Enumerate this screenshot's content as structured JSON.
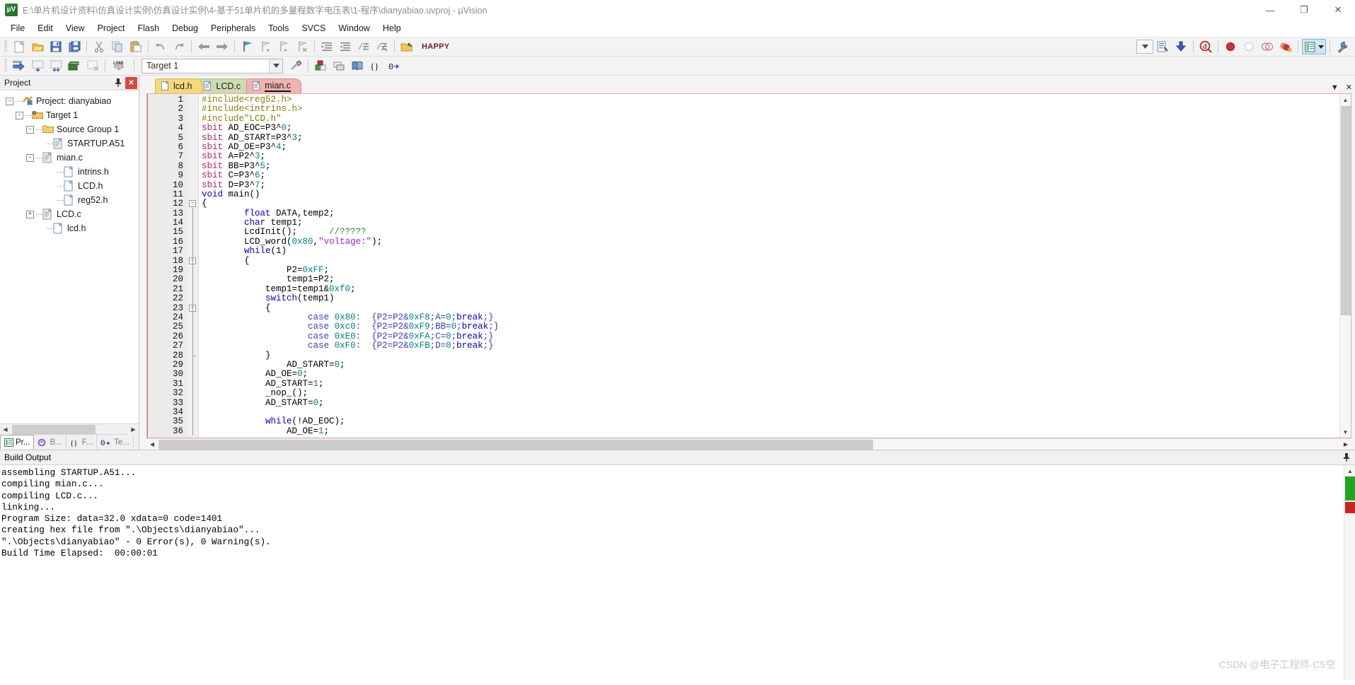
{
  "window": {
    "title": "E:\\单片机设计资料\\仿真设计实例\\仿真设计实例\\4-基于51单片机的多量程数字电压表\\1-程序\\dianyabiao.uvproj - µVision",
    "logo_text": "µV",
    "minimize": "—",
    "maximize": "❐",
    "close": "✕"
  },
  "menubar": {
    "items": [
      "File",
      "Edit",
      "View",
      "Project",
      "Flash",
      "Debug",
      "Peripherals",
      "Tools",
      "SVCS",
      "Window",
      "Help"
    ]
  },
  "toolbar1": {
    "buttons": [
      {
        "name": "new-file-icon",
        "title": "New"
      },
      {
        "name": "open-file-icon",
        "title": "Open"
      },
      {
        "name": "save-icon",
        "title": "Save"
      },
      {
        "name": "save-all-icon",
        "title": "Save All"
      },
      {
        "name": "cut-icon",
        "title": "Cut"
      },
      {
        "name": "copy-icon",
        "title": "Copy"
      },
      {
        "name": "paste-icon",
        "title": "Paste"
      },
      {
        "name": "undo-icon",
        "title": "Undo"
      },
      {
        "name": "redo-icon",
        "title": "Redo"
      },
      {
        "name": "back-icon",
        "title": "Back"
      },
      {
        "name": "forward-icon",
        "title": "Forward"
      },
      {
        "name": "bookmark-toggle-icon",
        "title": "Insert/Remove Bookmark"
      },
      {
        "name": "bookmark-prev-icon",
        "title": "Previous Bookmark"
      },
      {
        "name": "bookmark-next-icon",
        "title": "Next Bookmark"
      },
      {
        "name": "bookmark-clear-icon",
        "title": "Clear All Bookmarks"
      },
      {
        "name": "indent-icon",
        "title": "Indent"
      },
      {
        "name": "outdent-icon",
        "title": "Outdent"
      },
      {
        "name": "comment-icon",
        "title": "Comment"
      },
      {
        "name": "uncomment-icon",
        "title": "Uncomment"
      },
      {
        "name": "open-folder-icon",
        "title": "Open Project"
      }
    ],
    "config_label": "HAPPY",
    "right_buttons": [
      {
        "name": "configure-wizard-icon",
        "title": "Configuration Wizard"
      },
      {
        "name": "download-icon",
        "title": "Download"
      },
      {
        "name": "debug-start-icon",
        "title": "Start/Stop Debug Session"
      },
      {
        "name": "breakpoint-insert-icon",
        "title": "Insert/Remove Breakpoint"
      },
      {
        "name": "breakpoint-disable-icon",
        "title": "Enable/Disable Breakpoint"
      },
      {
        "name": "breakpoint-disable-all-icon",
        "title": "Disable All Breakpoints"
      },
      {
        "name": "breakpoint-kill-all-icon",
        "title": "Kill All Breakpoints"
      },
      {
        "name": "window-layout-icon",
        "title": "Manage Window Layout"
      },
      {
        "name": "options-wrench-icon",
        "title": "Options for Target"
      }
    ]
  },
  "toolbar2": {
    "buttons": [
      {
        "name": "build-icon",
        "title": "Translate"
      },
      {
        "name": "build-target-icon",
        "title": "Build Target"
      },
      {
        "name": "rebuild-all-icon",
        "title": "Rebuild All"
      },
      {
        "name": "batch-build-icon",
        "title": "Batch Build"
      },
      {
        "name": "stop-build-icon",
        "title": "Stop Build"
      },
      {
        "name": "load-icon",
        "title": "Download to Flash"
      }
    ],
    "target_value": "Target 1",
    "right_buttons": [
      {
        "name": "target-options-icon",
        "title": "Options for Target"
      },
      {
        "name": "manage-project-items-icon",
        "title": "Manage Project Items"
      },
      {
        "name": "multi-project-icon",
        "title": "Multi-Project"
      },
      {
        "name": "book-icon",
        "title": "Books"
      },
      {
        "name": "functions-icon",
        "title": "Functions"
      },
      {
        "name": "templates-icon",
        "title": "Templates"
      }
    ]
  },
  "project_panel": {
    "title": "Project",
    "pin_icon": "auto-hide-pin-icon",
    "close_icon": "close-icon",
    "tree": [
      {
        "label": "Project: dianyabiao",
        "depth": 0,
        "toggle": "-",
        "icon": "project-icon"
      },
      {
        "label": "Target 1",
        "depth": 1,
        "toggle": "-",
        "icon": "target-folder-icon"
      },
      {
        "label": "Source Group 1",
        "depth": 2,
        "toggle": "-",
        "icon": "folder-icon"
      },
      {
        "label": "STARTUP.A51",
        "depth": 3,
        "toggle": "",
        "icon": "source-file-icon"
      },
      {
        "label": "mian.c",
        "depth": 3,
        "toggle": "-",
        "icon": "source-file-icon"
      },
      {
        "label": "intrins.h",
        "depth": 4,
        "toggle": "",
        "icon": "header-file-icon"
      },
      {
        "label": "LCD.h",
        "depth": 4,
        "toggle": "",
        "icon": "header-file-icon"
      },
      {
        "label": "reg52.h",
        "depth": 4,
        "toggle": "",
        "icon": "header-file-icon"
      },
      {
        "label": "LCD.c",
        "depth": 3,
        "toggle": "+",
        "icon": "source-file-icon"
      },
      {
        "label": "lcd.h",
        "depth": 3,
        "toggle": "",
        "icon": "header-file-icon"
      }
    ],
    "tabs": [
      {
        "label": "Pr...",
        "icon": "project-tab-icon",
        "active": true
      },
      {
        "label": "B...",
        "icon": "books-tab-icon",
        "active": false
      },
      {
        "label": "F...",
        "icon": "functions-tab-icon",
        "active": false
      },
      {
        "label": "Te...",
        "icon": "templates-tab-icon",
        "active": false
      }
    ]
  },
  "editor": {
    "tabs": [
      {
        "label": "lcd.h",
        "active": false
      },
      {
        "label": "LCD.c",
        "active": false
      },
      {
        "label": "mian.c",
        "active": true
      }
    ],
    "tab_menu_icon": "chevron-down-icon",
    "tab_close_icon": "close-icon",
    "lines": [
      {
        "n": 1,
        "fold": "",
        "tokens": [
          {
            "t": "#include<reg52.h>",
            "c": "k-pre"
          }
        ],
        "indent": 0
      },
      {
        "n": 2,
        "fold": "",
        "tokens": [
          {
            "t": "#include<intrins.h>",
            "c": "k-pre"
          }
        ],
        "indent": 0
      },
      {
        "n": 3,
        "fold": "",
        "tokens": [
          {
            "t": "#include\"LCD.h\"",
            "c": "k-pre"
          }
        ],
        "indent": 0
      },
      {
        "n": 4,
        "fold": "",
        "tokens": [
          {
            "t": "sbit",
            "c": "k-sb"
          },
          {
            "t": " AD_EOC=P3^",
            "c": ""
          },
          {
            "t": "0",
            "c": "k-num"
          },
          {
            "t": ";",
            "c": ""
          }
        ],
        "indent": 0
      },
      {
        "n": 5,
        "fold": "",
        "tokens": [
          {
            "t": "sbit",
            "c": "k-sb"
          },
          {
            "t": " AD_START=P3^",
            "c": ""
          },
          {
            "t": "3",
            "c": "k-num"
          },
          {
            "t": ";",
            "c": ""
          }
        ],
        "indent": 0
      },
      {
        "n": 6,
        "fold": "",
        "tokens": [
          {
            "t": "sbit",
            "c": "k-sb"
          },
          {
            "t": " AD_OE=P3^",
            "c": ""
          },
          {
            "t": "4",
            "c": "k-num"
          },
          {
            "t": ";",
            "c": ""
          }
        ],
        "indent": 0
      },
      {
        "n": 7,
        "fold": "",
        "tokens": [
          {
            "t": "sbit",
            "c": "k-sb"
          },
          {
            "t": " A=P2^",
            "c": ""
          },
          {
            "t": "3",
            "c": "k-num"
          },
          {
            "t": ";",
            "c": ""
          }
        ],
        "indent": 0
      },
      {
        "n": 8,
        "fold": "",
        "tokens": [
          {
            "t": "sbit",
            "c": "k-sb"
          },
          {
            "t": " BB=P3^",
            "c": ""
          },
          {
            "t": "5",
            "c": "k-num"
          },
          {
            "t": ";",
            "c": ""
          }
        ],
        "indent": 0
      },
      {
        "n": 9,
        "fold": "",
        "tokens": [
          {
            "t": "sbit",
            "c": "k-sb"
          },
          {
            "t": " C=P3^",
            "c": ""
          },
          {
            "t": "6",
            "c": "k-num"
          },
          {
            "t": ";",
            "c": ""
          }
        ],
        "indent": 0
      },
      {
        "n": 10,
        "fold": "",
        "tokens": [
          {
            "t": "sbit",
            "c": "k-sb"
          },
          {
            "t": " D=P3^",
            "c": ""
          },
          {
            "t": "7",
            "c": "k-num"
          },
          {
            "t": ";",
            "c": ""
          }
        ],
        "indent": 0
      },
      {
        "n": 11,
        "fold": "",
        "tokens": [
          {
            "t": "void",
            "c": "k-kw"
          },
          {
            "t": " main()",
            "c": ""
          }
        ],
        "indent": 0
      },
      {
        "n": 12,
        "fold": "-",
        "tokens": [
          {
            "t": "{",
            "c": ""
          }
        ],
        "indent": 0
      },
      {
        "n": 13,
        "fold": "",
        "tokens": [
          {
            "t": "float",
            "c": "k-kw"
          },
          {
            "t": " DATA,temp2;",
            "c": ""
          }
        ],
        "indent": 2
      },
      {
        "n": 14,
        "fold": "",
        "tokens": [
          {
            "t": "char",
            "c": "k-kw"
          },
          {
            "t": " temp1;",
            "c": ""
          }
        ],
        "indent": 2
      },
      {
        "n": 15,
        "fold": "",
        "tokens": [
          {
            "t": "LcdInit();      ",
            "c": ""
          },
          {
            "t": "//?????",
            "c": "k-cmt"
          }
        ],
        "indent": 2
      },
      {
        "n": 16,
        "fold": "",
        "tokens": [
          {
            "t": "LCD_word(",
            "c": ""
          },
          {
            "t": "0x80",
            "c": "k-num"
          },
          {
            "t": ",",
            "c": ""
          },
          {
            "t": "\"voltage:\"",
            "c": "k-str"
          },
          {
            "t": ");",
            "c": ""
          }
        ],
        "indent": 2
      },
      {
        "n": 17,
        "fold": "",
        "tokens": [
          {
            "t": "while",
            "c": "k-kw"
          },
          {
            "t": "(1)",
            "c": ""
          }
        ],
        "indent": 2
      },
      {
        "n": 18,
        "fold": "-",
        "tokens": [
          {
            "t": "{",
            "c": ""
          }
        ],
        "indent": 2
      },
      {
        "n": 19,
        "fold": "",
        "tokens": [
          {
            "t": "P2=",
            "c": ""
          },
          {
            "t": "0xFF",
            "c": "k-num"
          },
          {
            "t": ";",
            "c": ""
          }
        ],
        "indent": 4
      },
      {
        "n": 20,
        "fold": "",
        "tokens": [
          {
            "t": "temp1=P2;",
            "c": ""
          }
        ],
        "indent": 4
      },
      {
        "n": 21,
        "fold": "",
        "tokens": [
          {
            "t": "temp1=temp1&",
            "c": ""
          },
          {
            "t": "0xf0",
            "c": "k-num"
          },
          {
            "t": ";",
            "c": ""
          }
        ],
        "indent": 3
      },
      {
        "n": 22,
        "fold": "",
        "tokens": [
          {
            "t": "switch",
            "c": "k-kw"
          },
          {
            "t": "(temp1)",
            "c": ""
          }
        ],
        "indent": 3
      },
      {
        "n": 23,
        "fold": "-",
        "tokens": [
          {
            "t": "{",
            "c": ""
          }
        ],
        "indent": 3
      },
      {
        "n": 24,
        "fold": "",
        "tokens": [
          {
            "t": "case",
            "c": "k-case"
          },
          {
            "t": " ",
            "c": ""
          },
          {
            "t": "0x80",
            "c": "k-num"
          },
          {
            "t": ":  {P2=P2&",
            "c": "k-case"
          },
          {
            "t": "0xF8",
            "c": "k-num"
          },
          {
            "t": ";A=",
            "c": "k-case"
          },
          {
            "t": "0",
            "c": "k-num"
          },
          {
            "t": ";",
            "c": "k-case"
          },
          {
            "t": "break",
            "c": "k-kw"
          },
          {
            "t": ";}",
            "c": "k-case"
          }
        ],
        "indent": 5
      },
      {
        "n": 25,
        "fold": "",
        "tokens": [
          {
            "t": "case",
            "c": "k-case"
          },
          {
            "t": " ",
            "c": ""
          },
          {
            "t": "0xc0",
            "c": "k-num"
          },
          {
            "t": ":  {P2=P2&",
            "c": "k-case"
          },
          {
            "t": "0xF9",
            "c": "k-num"
          },
          {
            "t": ";BB=",
            "c": "k-case"
          },
          {
            "t": "0",
            "c": "k-num"
          },
          {
            "t": ";",
            "c": "k-case"
          },
          {
            "t": "break",
            "c": "k-kw"
          },
          {
            "t": ";}",
            "c": "k-case"
          }
        ],
        "indent": 5
      },
      {
        "n": 26,
        "fold": "",
        "tokens": [
          {
            "t": "case",
            "c": "k-case"
          },
          {
            "t": " ",
            "c": ""
          },
          {
            "t": "0xE0",
            "c": "k-num"
          },
          {
            "t": ":  {P2=P2&",
            "c": "k-case"
          },
          {
            "t": "0xFA",
            "c": "k-num"
          },
          {
            "t": ";C=",
            "c": "k-case"
          },
          {
            "t": "0",
            "c": "k-num"
          },
          {
            "t": ";",
            "c": "k-case"
          },
          {
            "t": "break",
            "c": "k-kw"
          },
          {
            "t": ";}",
            "c": "k-case"
          }
        ],
        "indent": 5
      },
      {
        "n": 27,
        "fold": "",
        "tokens": [
          {
            "t": "case",
            "c": "k-case"
          },
          {
            "t": " ",
            "c": ""
          },
          {
            "t": "0xF0",
            "c": "k-num"
          },
          {
            "t": ":  {P2=P2&",
            "c": "k-case"
          },
          {
            "t": "0xFB",
            "c": "k-num"
          },
          {
            "t": ";D=",
            "c": "k-case"
          },
          {
            "t": "0",
            "c": "k-num"
          },
          {
            "t": ";",
            "c": "k-case"
          },
          {
            "t": "break",
            "c": "k-kw"
          },
          {
            "t": ";}",
            "c": "k-case"
          }
        ],
        "indent": 5
      },
      {
        "n": 28,
        "fold": "e",
        "tokens": [
          {
            "t": "}",
            "c": ""
          }
        ],
        "indent": 3
      },
      {
        "n": 29,
        "fold": "",
        "tokens": [
          {
            "t": "AD_START=",
            "c": ""
          },
          {
            "t": "0",
            "c": "k-num"
          },
          {
            "t": ";",
            "c": ""
          }
        ],
        "indent": 4
      },
      {
        "n": 30,
        "fold": "",
        "tokens": [
          {
            "t": "AD_OE=",
            "c": ""
          },
          {
            "t": "0",
            "c": "k-num"
          },
          {
            "t": ";",
            "c": ""
          }
        ],
        "indent": 3
      },
      {
        "n": 31,
        "fold": "",
        "tokens": [
          {
            "t": "AD_START=",
            "c": ""
          },
          {
            "t": "1",
            "c": "k-num"
          },
          {
            "t": ";",
            "c": ""
          }
        ],
        "indent": 3
      },
      {
        "n": 32,
        "fold": "",
        "tokens": [
          {
            "t": "_nop_();",
            "c": ""
          }
        ],
        "indent": 3
      },
      {
        "n": 33,
        "fold": "",
        "tokens": [
          {
            "t": "AD_START=",
            "c": ""
          },
          {
            "t": "0",
            "c": "k-num"
          },
          {
            "t": ";",
            "c": ""
          }
        ],
        "indent": 3
      },
      {
        "n": 34,
        "fold": "",
        "tokens": [],
        "indent": 0
      },
      {
        "n": 35,
        "fold": "",
        "tokens": [
          {
            "t": "while",
            "c": "k-kw"
          },
          {
            "t": "(!AD_EOC);",
            "c": ""
          }
        ],
        "indent": 3
      },
      {
        "n": 36,
        "fold": "",
        "tokens": [
          {
            "t": "AD_OE=",
            "c": ""
          },
          {
            "t": "1",
            "c": "k-num"
          },
          {
            "t": ";",
            "c": ""
          }
        ],
        "indent": 4
      }
    ]
  },
  "build_output": {
    "title": "Build Output",
    "pin_icon": "auto-hide-pin-icon",
    "lines": [
      "assembling STARTUP.A51...",
      "compiling mian.c...",
      "compiling LCD.c...",
      "linking...",
      "Program Size: data=32.0 xdata=0 code=1401",
      "creating hex file from \".\\Objects\\dianyabiao\"...",
      "\".\\Objects\\dianyabiao\" - 0 Error(s), 0 Warning(s).",
      "Build Time Elapsed:  00:00:01"
    ]
  },
  "watermark": {
    "text": "CSDN @电子工程师-C5空"
  },
  "colors": {
    "accent_red": "#d94a3d",
    "tab_active": "#f0b3b1",
    "tab_lcd": "#cddcb0",
    "tab_lcdh": "#f7d97a",
    "keyword_blue": "#0000d0",
    "preproc_olive": "#808000",
    "number_teal": "#008080",
    "string_purple": "#a020f0",
    "comment_green": "#2e8b2e"
  }
}
